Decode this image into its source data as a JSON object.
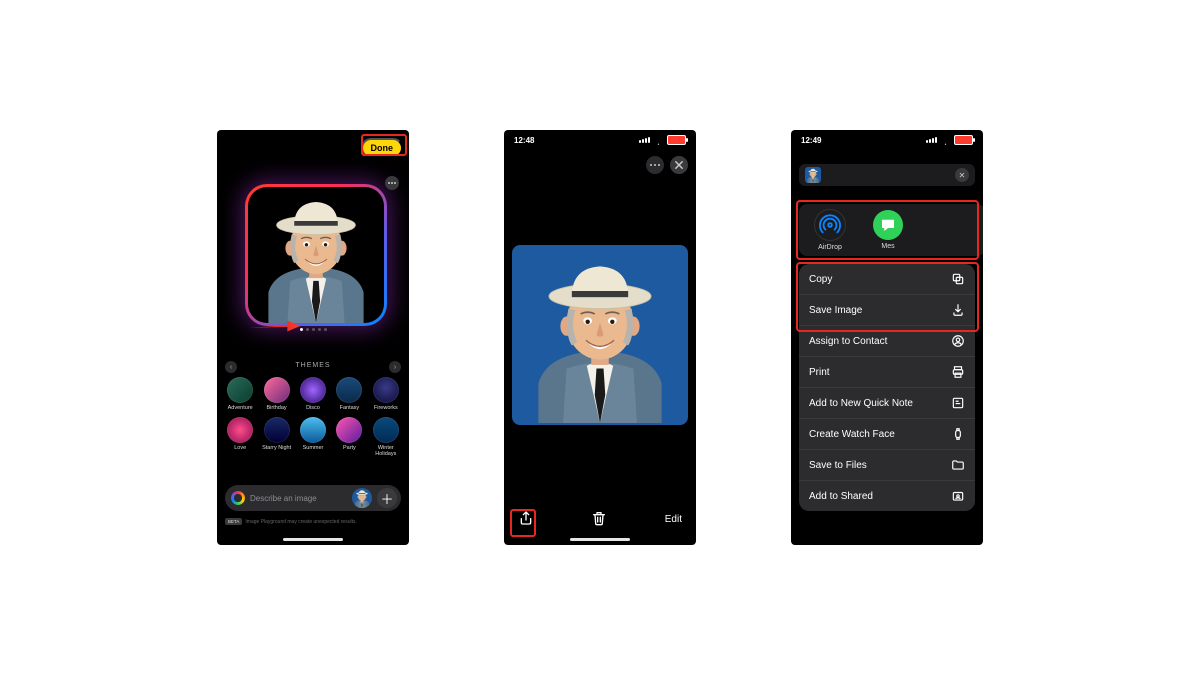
{
  "phone1": {
    "done_label": "Done",
    "themes_heading": "THEMES",
    "themes": [
      {
        "label": "Adventure",
        "g": "linear-gradient(135deg,#2a6b5c,#0a3d2c)"
      },
      {
        "label": "Birthday",
        "g": "linear-gradient(135deg,#ff6b9d,#6b2b7a)"
      },
      {
        "label": "Disco",
        "g": "radial-gradient(circle,#a066ff,#2a0a66)"
      },
      {
        "label": "Fantasy",
        "g": "linear-gradient(180deg,#1a4a7a,#0a2a4a)"
      },
      {
        "label": "Fireworks",
        "g": "radial-gradient(circle at 50% 40%,#3a3a88,#0a0a33)"
      },
      {
        "label": "Love",
        "g": "radial-gradient(circle,#ff4d8d,#8a0d4d)"
      },
      {
        "label": "Starry Night",
        "g": "linear-gradient(180deg,#1a2a66,#000033)"
      },
      {
        "label": "Summer",
        "g": "linear-gradient(180deg,#4dbef0,#0a5a99)"
      },
      {
        "label": "Party",
        "g": "linear-gradient(135deg,#ff58b0,#5a1aa0)"
      },
      {
        "label": "Winter Holidays",
        "g": "linear-gradient(180deg,#0a4a7a,#012a55)"
      }
    ],
    "input_placeholder": "Describe an image",
    "beta_label": "BETA",
    "fineprint": "Image Playground may create unexpected results."
  },
  "phone2": {
    "time": "12:48",
    "battery_pct": "14",
    "edit_label": "Edit"
  },
  "phone3": {
    "time": "12:49",
    "battery_pct": "14",
    "share_destinations": [
      {
        "label": "AirDrop",
        "type": "airdrop"
      },
      {
        "label": "Mes",
        "type": "messages"
      }
    ],
    "actions": [
      {
        "label": "Copy",
        "icon": "copy"
      },
      {
        "label": "Save Image",
        "icon": "save"
      },
      {
        "label": "Assign to Contact",
        "icon": "contact"
      },
      {
        "label": "Print",
        "icon": "print"
      },
      {
        "label": "Add to New Quick Note",
        "icon": "note"
      },
      {
        "label": "Create Watch Face",
        "icon": "watch"
      },
      {
        "label": "Save to Files",
        "icon": "files"
      },
      {
        "label": "Add to Shared",
        "icon": "shared"
      }
    ]
  }
}
